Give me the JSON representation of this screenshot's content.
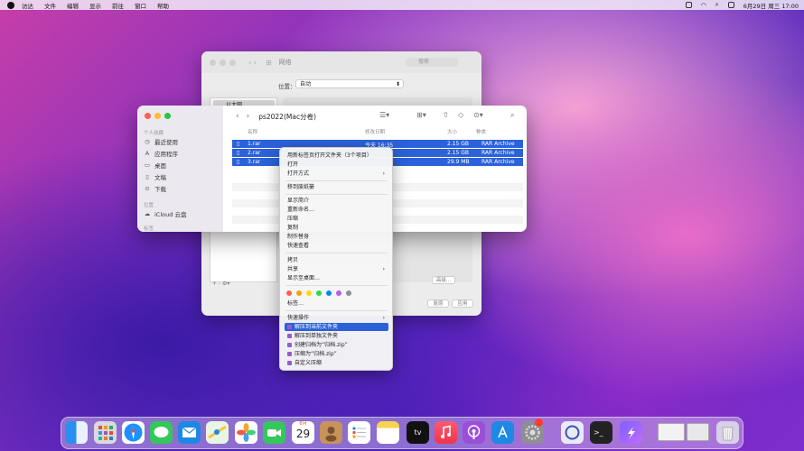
{
  "menubar": {
    "items": [
      "访达",
      "文件",
      "编辑",
      "显示",
      "前往",
      "窗口",
      "帮助"
    ],
    "clock": "6月29日 周三 17:00"
  },
  "back_window": {
    "title": "网络",
    "search_placeholder": "搜索",
    "location_label": "位置：",
    "location_value": "自动",
    "sidebar_item": "以太网",
    "advanced_button": "高级...",
    "revert_button": "复原",
    "apply_button": "应用",
    "plus_minus": "+ - ⚙▾"
  },
  "finder": {
    "title": "ps2022(Mac分卷)",
    "sidebar": {
      "favorites_header": "个人收藏",
      "items": [
        {
          "icon": "clock-icon",
          "label": "最近使用"
        },
        {
          "icon": "app-icon",
          "label": "应用程序"
        },
        {
          "icon": "desktop-icon",
          "label": "桌面"
        },
        {
          "icon": "document-icon",
          "label": "文稿"
        },
        {
          "icon": "download-icon",
          "label": "下载"
        }
      ],
      "icloud_header": "位置",
      "icloud_item": "iCloud 云盘",
      "tags_header": "标签"
    },
    "columns": [
      "名称",
      "修改日期",
      "大小",
      "种类"
    ],
    "rows": [
      {
        "name": "1.rar",
        "date": "今天 16:35",
        "size": "2.15 GB",
        "kind": "RAR Archive"
      },
      {
        "name": "2.rar",
        "date": "",
        "size": "2.15 GB",
        "kind": "RAR Archive"
      },
      {
        "name": "3.rar",
        "date": "",
        "size": "29.9 MB",
        "kind": "RAR Archive"
      }
    ]
  },
  "context_menu": {
    "items": [
      {
        "label": "用新标签页打开文件夹（3个项目）",
        "submenu": false
      },
      {
        "label": "打开",
        "submenu": false
      },
      {
        "label": "打开方式",
        "submenu": true
      },
      {
        "label": "移到废纸篓",
        "submenu": false
      },
      {
        "label": "显示简介",
        "submenu": false
      },
      {
        "label": "重新命名…",
        "submenu": false
      },
      {
        "label": "压缩",
        "submenu": false
      },
      {
        "label": "复制",
        "submenu": false
      },
      {
        "label": "制作替身",
        "submenu": false
      },
      {
        "label": "快速查看",
        "submenu": false
      },
      {
        "label": "拷贝",
        "submenu": false
      },
      {
        "label": "共享",
        "submenu": true
      },
      {
        "label": "显示至桌面…",
        "submenu": false
      },
      {
        "label": "标签…",
        "submenu": false
      },
      {
        "label": "快速操作",
        "submenu": true
      },
      {
        "label": "解压到当前文件夹",
        "submenu": false,
        "highlighted": true
      },
      {
        "label": "解压到单独文件夹",
        "submenu": false
      },
      {
        "label": "创建归档为“归档.zip”",
        "submenu": false
      },
      {
        "label": "压缩为“归档.zip”",
        "submenu": false
      },
      {
        "label": "自定义压缩",
        "submenu": false
      }
    ],
    "tag_colors": [
      "#ff5f57",
      "#ff9f0a",
      "#ffd60a",
      "#32d74b",
      "#0a84ff",
      "#bf5af2",
      "#8e8e93"
    ]
  },
  "dock": {
    "calendar_month": "6月",
    "calendar_day": "29",
    "apps": [
      "finder-icon",
      "launchpad-icon",
      "safari-icon",
      "messages-icon",
      "mail-icon",
      "maps-icon",
      "photos-icon",
      "facetime-icon",
      "calendar-icon",
      "contacts-icon",
      "reminders-icon",
      "notes-icon",
      "tv-icon",
      "music-icon",
      "podcasts-icon",
      "appstore-icon",
      "settings-icon",
      "sync-icon",
      "terminal-icon",
      "shortcuts-icon",
      "window-icon",
      "trash-icon"
    ],
    "tv_label": "tv"
  },
  "colors": {
    "accent": "#2b62d9",
    "wallpaper_primary": "#6a2cc9",
    "wallpaper_secondary": "#e86cc8"
  }
}
